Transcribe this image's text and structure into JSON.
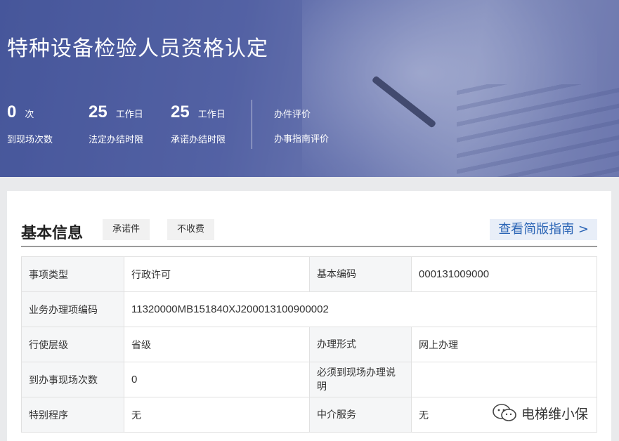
{
  "banner": {
    "title": "特种设备检验人员资格认定",
    "stats": [
      {
        "num": "0",
        "unit": "次",
        "label": "到现场次数"
      },
      {
        "num": "25",
        "unit": "工作日",
        "label": "法定办结时限"
      },
      {
        "num": "25",
        "unit": "工作日",
        "label": "承诺办结时限"
      }
    ],
    "rate_items": [
      "办件评价",
      "办事指南评价"
    ]
  },
  "section": {
    "title": "基本信息",
    "tags": [
      "承诺件",
      "不收费"
    ],
    "guide_link": "查看简版指南 >"
  },
  "table": {
    "rows": [
      {
        "k1": "事项类型",
        "v1": "行政许可",
        "k2": "基本编码",
        "v2": "000131009000"
      },
      {
        "k1": "业务办理项编码",
        "v1": "11320000MB151840XJ200013100900002"
      },
      {
        "k1": "行使层级",
        "v1": "省级",
        "k2": "办理形式",
        "v2": "网上办理"
      },
      {
        "k1": "到办事现场次数",
        "v1": "0",
        "k2": "必须到现场办理说明",
        "v2": ""
      },
      {
        "k1": "特别程序",
        "v1": "无",
        "k2": "中介服务",
        "v2": "无"
      }
    ]
  },
  "watermark": {
    "text": "电梯维小保",
    "icon": "wechat-icon"
  }
}
